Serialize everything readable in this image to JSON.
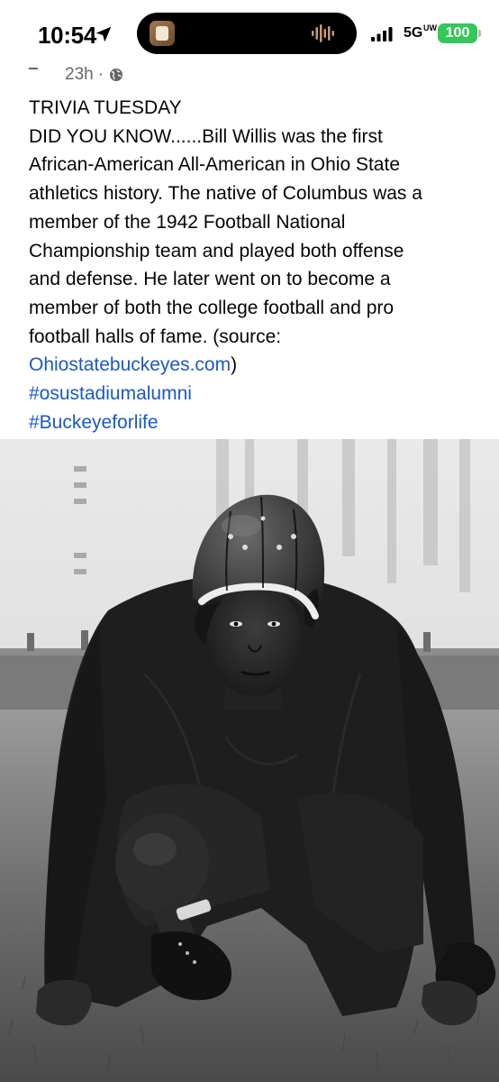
{
  "status_bar": {
    "time": "10:54",
    "network": "5G",
    "network_sub": "UW",
    "battery": "100",
    "battery_color": "#34c759",
    "icons": [
      "location-arrow-icon",
      "audio-waveform-icon",
      "signal-bars-icon"
    ]
  },
  "post": {
    "timestamp": "23h",
    "separator": "·",
    "privacy_icon": "globe-icon",
    "lines": [
      "TRIVIA TUESDAY",
      "DID YOU KNOW......Bill Willis was the first",
      "African-American All-American in Ohio State",
      "athletics history. The native of Columbus was a",
      "member of the 1942 Football National",
      "Championship team and played both offense",
      "and defense. He later went on to become a",
      "member of both the college football and pro",
      "football halls of fame. (source:"
    ],
    "source_link": "Ohiostatebuckeyes.com",
    "source_close": ")",
    "hashtags": [
      "#osustadiumalumni",
      "#Buckeyeforlife"
    ],
    "link_color": "#1a58c9"
  }
}
